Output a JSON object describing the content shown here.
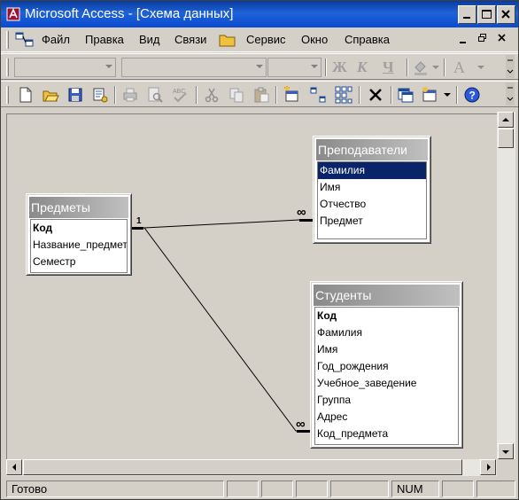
{
  "window": {
    "title": "Microsoft Access - [Схема данных]"
  },
  "menu": {
    "items": [
      {
        "label": "Файл"
      },
      {
        "label": "Правка"
      },
      {
        "label": "Вид"
      },
      {
        "label": "Связи"
      },
      {
        "label": "Сервис"
      },
      {
        "label": "Окно"
      },
      {
        "label": "Справка"
      }
    ]
  },
  "format_toolbar": {
    "bold": "Ж",
    "italic": "К",
    "underline": "Ч",
    "font_color": "A"
  },
  "tables": {
    "subjects": {
      "title": "Предметы",
      "fields": [
        "Код",
        "Название_предмета",
        "Семестр"
      ]
    },
    "teachers": {
      "title": "Преподаватели",
      "fields": [
        "Фамилия",
        "Имя",
        "Отчество",
        "Предмет"
      ]
    },
    "students": {
      "title": "Студенты",
      "fields": [
        "Код",
        "Фамилия",
        "Имя",
        "Год_рождения",
        "Учебное_заведение",
        "Группа",
        "Адрес",
        "Код_предмета"
      ]
    }
  },
  "relations": {
    "one": "1",
    "many": "∞"
  },
  "status": {
    "text": "Готово",
    "num": "NUM"
  },
  "colors": {
    "title_bar": "#0a3c9c",
    "selection": "#0a246a",
    "background": "#d4d0c8"
  }
}
